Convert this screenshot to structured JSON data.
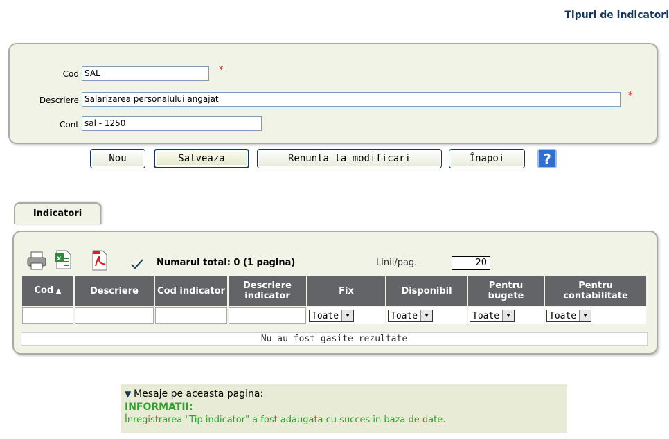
{
  "header": {
    "title": "Tipuri de indicatori"
  },
  "form": {
    "cod": {
      "label": "Cod",
      "value": "SAL"
    },
    "descriere": {
      "label": "Descriere",
      "value": "Salarizarea personalului angajat"
    },
    "cont": {
      "label": "Cont",
      "value": "sal - 1250"
    },
    "required_mark": "*"
  },
  "buttons": {
    "nou": "Nou",
    "salveaza": "Salveaza",
    "renunta": "Renunta la modificari",
    "inapoi": "Înapoi",
    "help": "?"
  },
  "tabs": [
    {
      "label": "Indicatori"
    }
  ],
  "grid": {
    "summary": "Numarul total: 0 (1 pagina)",
    "lines_label": "Linii/pag.",
    "lines_value": "20",
    "columns": [
      {
        "label": "Cod",
        "sort": "ascending"
      },
      {
        "label": "Descriere"
      },
      {
        "label": "Cod indicator"
      },
      {
        "label": "Descriere indicator"
      },
      {
        "label": "Fix"
      },
      {
        "label": "Disponibil"
      },
      {
        "label": "Pentru bugete"
      },
      {
        "label": "Pentru contabilitate"
      }
    ],
    "filters": {
      "fix": "Toate",
      "disponibil": "Toate",
      "bugete": "Toate",
      "contabilitate": "Toate"
    },
    "empty_message": "Nu au fost gasite rezultate"
  },
  "messages": {
    "title": "Mesaje pe aceasta pagina:",
    "heading": "INFORMATII:",
    "text": "Înregistrarea \"Tip indicator\" a fost adaugata cu succes în baza de date."
  },
  "colors": {
    "header_blue": "#16375c",
    "panel_bg": "#f1f3e6",
    "table_header": "#636468",
    "info_green": "#2ea02e"
  }
}
